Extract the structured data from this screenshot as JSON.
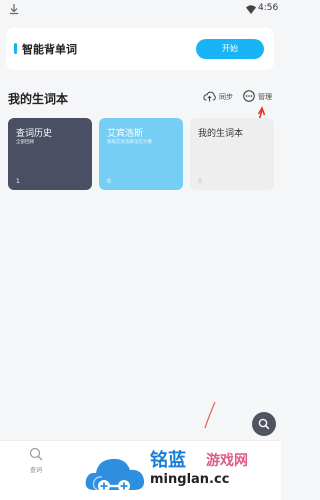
{
  "status_bar": {
    "time": "4:56",
    "left_icon": "download-arrow-icon",
    "wifi_icon": "wifi-icon"
  },
  "smart_card": {
    "title": "智能背单词",
    "start_label": "开始"
  },
  "wordbook_section": {
    "title": "我的生词本",
    "sync_label": "同步",
    "sync_icon": "cloud-sync-icon",
    "manage_label": "管理",
    "manage_icon": "more-dots-icon"
  },
  "wordbooks": [
    {
      "title": "查词历史",
      "subtitle": "全部回顾",
      "count": "1"
    },
    {
      "title": "艾宾浩斯",
      "subtitle": "按照艾宾浩斯记忆计算",
      "count": "0"
    },
    {
      "title": "我的生词本",
      "subtitle": "",
      "count": "0"
    }
  ],
  "fab": {
    "icon": "search-icon"
  },
  "bottom_nav": {
    "items": [
      {
        "label": "查词",
        "icon": "search-icon"
      }
    ]
  },
  "watermark": {
    "cn_a": "铭蓝",
    "cn_b": "游戏网",
    "en": "minglan.cc"
  },
  "colors": {
    "accent": "#18b4f5",
    "card_history": "#4a4f64",
    "card_aibinghaosi": "#76cef5",
    "card_mine": "#eeeeee",
    "annotation_arrow": "#e23b2e"
  }
}
